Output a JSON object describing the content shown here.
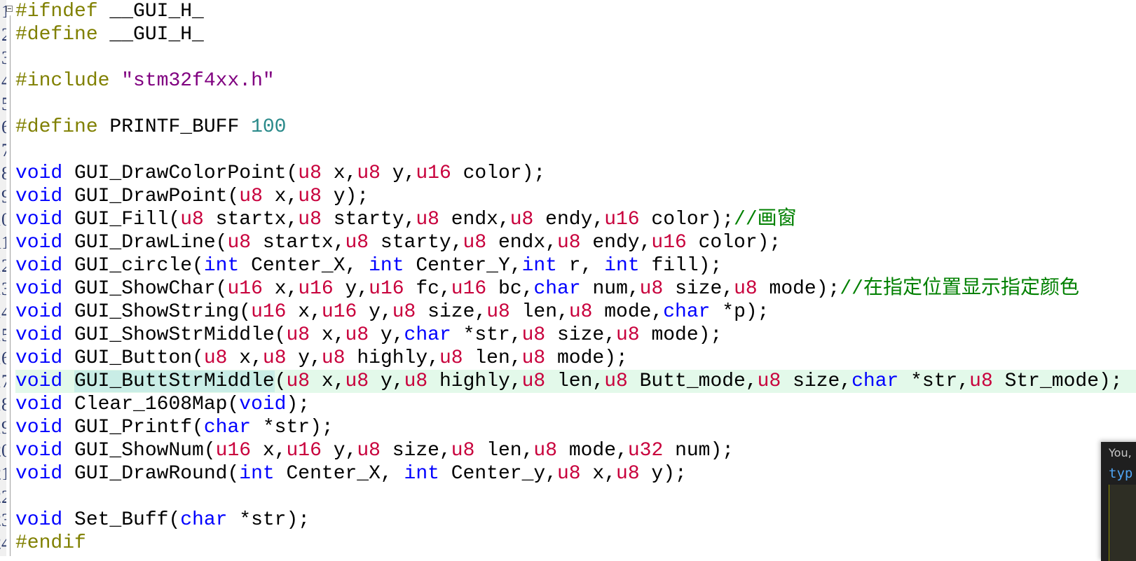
{
  "editor": {
    "current_line": 17,
    "highlight_word": "GUI_ButtStrMiddle",
    "lines": [
      "#ifndef __GUI_H_",
      "#define __GUI_H_",
      "",
      "#include \"stm32f4xx.h\"",
      "",
      "#define PRINTF_BUFF 100",
      "",
      "void GUI_DrawColorPoint(u8 x,u8 y,u16 color);",
      "void GUI_DrawPoint(u8 x,u8 y);",
      "void GUI_Fill(u8 startx,u8 starty,u8 endx,u8 endy,u16 color);//画窗",
      "void GUI_DrawLine(u8 startx,u8 starty,u8 endx,u8 endy,u16 color);",
      "void GUI_circle(int Center_X, int Center_Y,int r, int fill);",
      "void GUI_ShowChar(u16 x,u16 y,u16 fc,u16 bc,char num,u8 size,u8 mode);//在指定位置显示指定颜色",
      "void GUI_ShowString(u16 x,u16 y,u8 size,u8 len,u8 mode,char *p);",
      "void GUI_ShowStrMiddle(u8 x,u8 y,char *str,u8 size,u8 mode);",
      "void GUI_Button(u8 x,u8 y,u8 highly,u8 len,u8 mode);",
      "void GUI_ButtStrMiddle(u8 x,u8 y,u8 highly,u8 len,u8 Butt_mode,u8 size,char *str,u8 Str_mode);",
      "void Clear_1608Map(void);",
      "void GUI_Printf(char *str);",
      "void GUI_ShowNum(u16 x,u16 y,u8 size,u8 len,u8 mode,u32 num);",
      "void GUI_DrawRound(int Center_X, int Center_y,u8 x,u8 y);",
      "",
      "void Set_Buff(char *str);",
      "#endif"
    ]
  },
  "colors": {
    "preprocessor": "#808000",
    "string": "#800080",
    "number": "#2a8a8a",
    "keyword": "#0000ff",
    "type": "#c8003c",
    "comment": "#008000",
    "current_line_bg": "#e3f9ea",
    "word_highlight_bg": "#c9ede6"
  },
  "popup": {
    "user_text": "You,",
    "code_text": "typ"
  }
}
